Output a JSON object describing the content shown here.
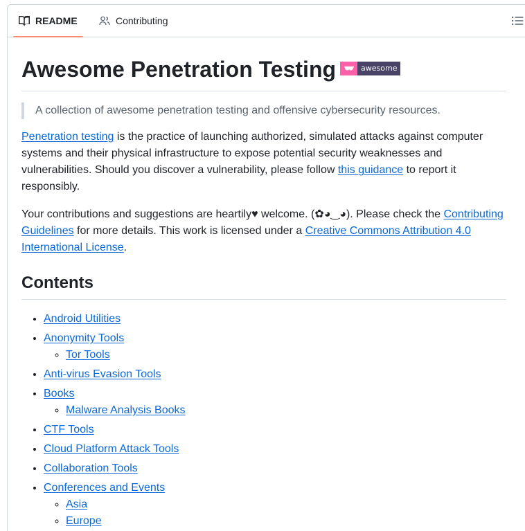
{
  "tabs": {
    "readme": "README",
    "contributing": "Contributing"
  },
  "title": "Awesome Penetration Testing",
  "badge": {
    "label": "awesome",
    "icon": "sunglasses-icon",
    "left_color": "#fc60a8",
    "right_color": "#494368"
  },
  "description": "A collection of awesome penetration testing and offensive cybersecurity resources.",
  "intro": {
    "link1": "Penetration testing",
    "text1": " is the practice of launching authorized, simulated attacks against computer systems and their physical infrastructure to expose potential security weaknesses and vulnerabilities. Should you discover a vulnerability, please follow ",
    "link2": "this guidance",
    "text2": " to report it responsibly."
  },
  "contrib": {
    "text1": "Your contributions and suggestions are heartily♥ welcome. (✿◕‿◕). Please check the ",
    "link1": "Contributing Guidelines",
    "text2": " for more details. This work is licensed under a ",
    "link2": "Creative Commons Attribution 4.0 International License",
    "text3": "."
  },
  "contents_heading": "Contents",
  "toc": [
    {
      "label": "Android Utilities"
    },
    {
      "label": "Anonymity Tools",
      "children": [
        "Tor Tools"
      ]
    },
    {
      "label": "Anti-virus Evasion Tools"
    },
    {
      "label": "Books",
      "children": [
        "Malware Analysis Books"
      ]
    },
    {
      "label": "CTF Tools"
    },
    {
      "label": "Cloud Platform Attack Tools"
    },
    {
      "label": "Collaboration Tools"
    },
    {
      "label": "Conferences and Events",
      "children": [
        "Asia",
        "Europe"
      ]
    }
  ],
  "colors": {
    "link": "#0969da",
    "accent_underline": "#fd8c73"
  }
}
